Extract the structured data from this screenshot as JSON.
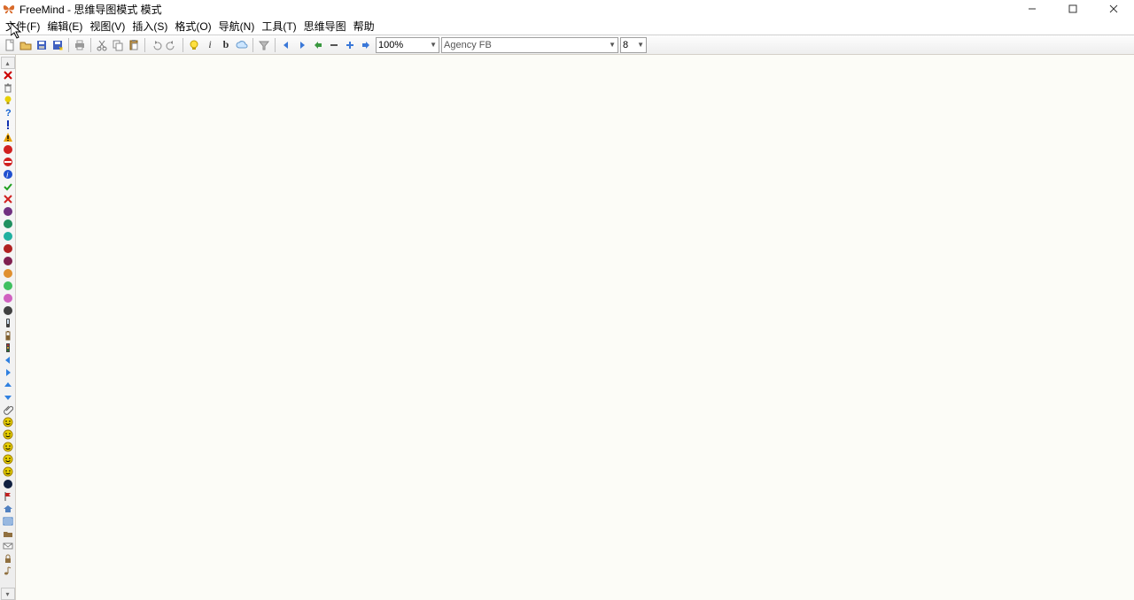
{
  "title": "FreeMind - 思维导图模式 模式",
  "menu": {
    "file": "文件(F)",
    "edit": "编辑(E)",
    "view": "视图(V)",
    "insert": "插入(S)",
    "format": "格式(O)",
    "nav": "导航(N)",
    "tools": "工具(T)",
    "mindmap": "思维导图",
    "help": "帮助"
  },
  "toolbar": {
    "zoom": "100%",
    "font": "Agency FB",
    "size": "8",
    "bold_char": "b",
    "italic_char": "i",
    "icons": {
      "new": "new-file-icon",
      "open": "open-file-icon",
      "save": "save-icon",
      "saveas": "saveas-icon",
      "print": "print-icon",
      "cut": "cut-icon",
      "copy": "copy-icon",
      "paste": "paste-icon",
      "undo": "undo-icon",
      "redo": "redo-icon",
      "idea": "idea-icon",
      "bold": "bold-icon",
      "italic": "italic-icon",
      "cloud": "cloud-icon",
      "color": "filter-icon",
      "nav_back": "nav-back-icon",
      "nav_fwd": "nav-fwd-icon",
      "nav_out": "nav-out-icon",
      "nav_collapse": "nav-collapse-icon",
      "nav_expand": "nav-expand-icon",
      "nav_toggle": "nav-toggle-icon"
    }
  },
  "iconbar": [
    {
      "name": "remove-last-icon",
      "color": "#c00",
      "shape": "x"
    },
    {
      "name": "remove-all-icon",
      "color": "#777",
      "shape": "trash"
    },
    {
      "name": "idea-icon",
      "color": "#e8d000",
      "shape": "bulb"
    },
    {
      "name": "help-icon",
      "color": "#1060d0",
      "shape": "question"
    },
    {
      "name": "important-icon",
      "color": "#1030b0",
      "shape": "exclaim"
    },
    {
      "name": "warning-icon",
      "color": "#e8a000",
      "shape": "warning"
    },
    {
      "name": "stop-icon",
      "color": "#d02020",
      "shape": "circle"
    },
    {
      "name": "no-entry-icon",
      "color": "#d02020",
      "shape": "nominus"
    },
    {
      "name": "info-icon",
      "color": "#2050d0",
      "shape": "info"
    },
    {
      "name": "ok-icon",
      "color": "#20a020",
      "shape": "check"
    },
    {
      "name": "not-ok-icon",
      "color": "#d02020",
      "shape": "x"
    },
    {
      "name": "priority-1-icon",
      "color": "#703080",
      "shape": "dot"
    },
    {
      "name": "priority-2-icon",
      "color": "#209060",
      "shape": "dot"
    },
    {
      "name": "priority-3-icon",
      "color": "#20b0a0",
      "shape": "dot"
    },
    {
      "name": "priority-4-icon",
      "color": "#b02020",
      "shape": "dot"
    },
    {
      "name": "priority-5-icon",
      "color": "#802050",
      "shape": "dot"
    },
    {
      "name": "priority-6-icon",
      "color": "#e09030",
      "shape": "dot"
    },
    {
      "name": "priority-7-icon",
      "color": "#40c060",
      "shape": "dot"
    },
    {
      "name": "priority-8-icon",
      "color": "#d060c0",
      "shape": "dot"
    },
    {
      "name": "priority-9-icon",
      "color": "#404040",
      "shape": "dot"
    },
    {
      "name": "phone-icon",
      "color": "#404040",
      "shape": "phone"
    },
    {
      "name": "battery-icon",
      "color": "#806030",
      "shape": "battery"
    },
    {
      "name": "traffic-icon",
      "color": "#208030",
      "shape": "traffic"
    },
    {
      "name": "arrow-left-icon",
      "color": "#3080e0",
      "shape": "arrowL"
    },
    {
      "name": "arrow-right-icon",
      "color": "#3080e0",
      "shape": "arrowR"
    },
    {
      "name": "arrow-up-icon",
      "color": "#3080e0",
      "shape": "arrowU"
    },
    {
      "name": "arrow-down-icon",
      "color": "#3080e0",
      "shape": "arrowD"
    },
    {
      "name": "attach-icon",
      "color": "#606060",
      "shape": "clip"
    },
    {
      "name": "smiley-happy-icon",
      "color": "#e8d000",
      "shape": "smile"
    },
    {
      "name": "smiley-neutral-icon",
      "color": "#e8d000",
      "shape": "smile"
    },
    {
      "name": "smiley-sad-icon",
      "color": "#e8d000",
      "shape": "smile"
    },
    {
      "name": "smiley-angry-icon",
      "color": "#e8d000",
      "shape": "smile"
    },
    {
      "name": "smiley-oh-icon",
      "color": "#e8d000",
      "shape": "smile"
    },
    {
      "name": "black-ball-icon",
      "color": "#102040",
      "shape": "dot"
    },
    {
      "name": "flag-icon",
      "color": "#c02020",
      "shape": "flag"
    },
    {
      "name": "home-icon",
      "color": "#5080c0",
      "shape": "home"
    },
    {
      "name": "list-icon",
      "color": "#3070c0",
      "shape": "list"
    },
    {
      "name": "folder-icon",
      "color": "#907040",
      "shape": "folder"
    },
    {
      "name": "mail-icon",
      "color": "#808080",
      "shape": "mail"
    },
    {
      "name": "password-icon",
      "color": "#907040",
      "shape": "lock"
    },
    {
      "name": "music-icon",
      "color": "#907040",
      "shape": "note"
    }
  ]
}
